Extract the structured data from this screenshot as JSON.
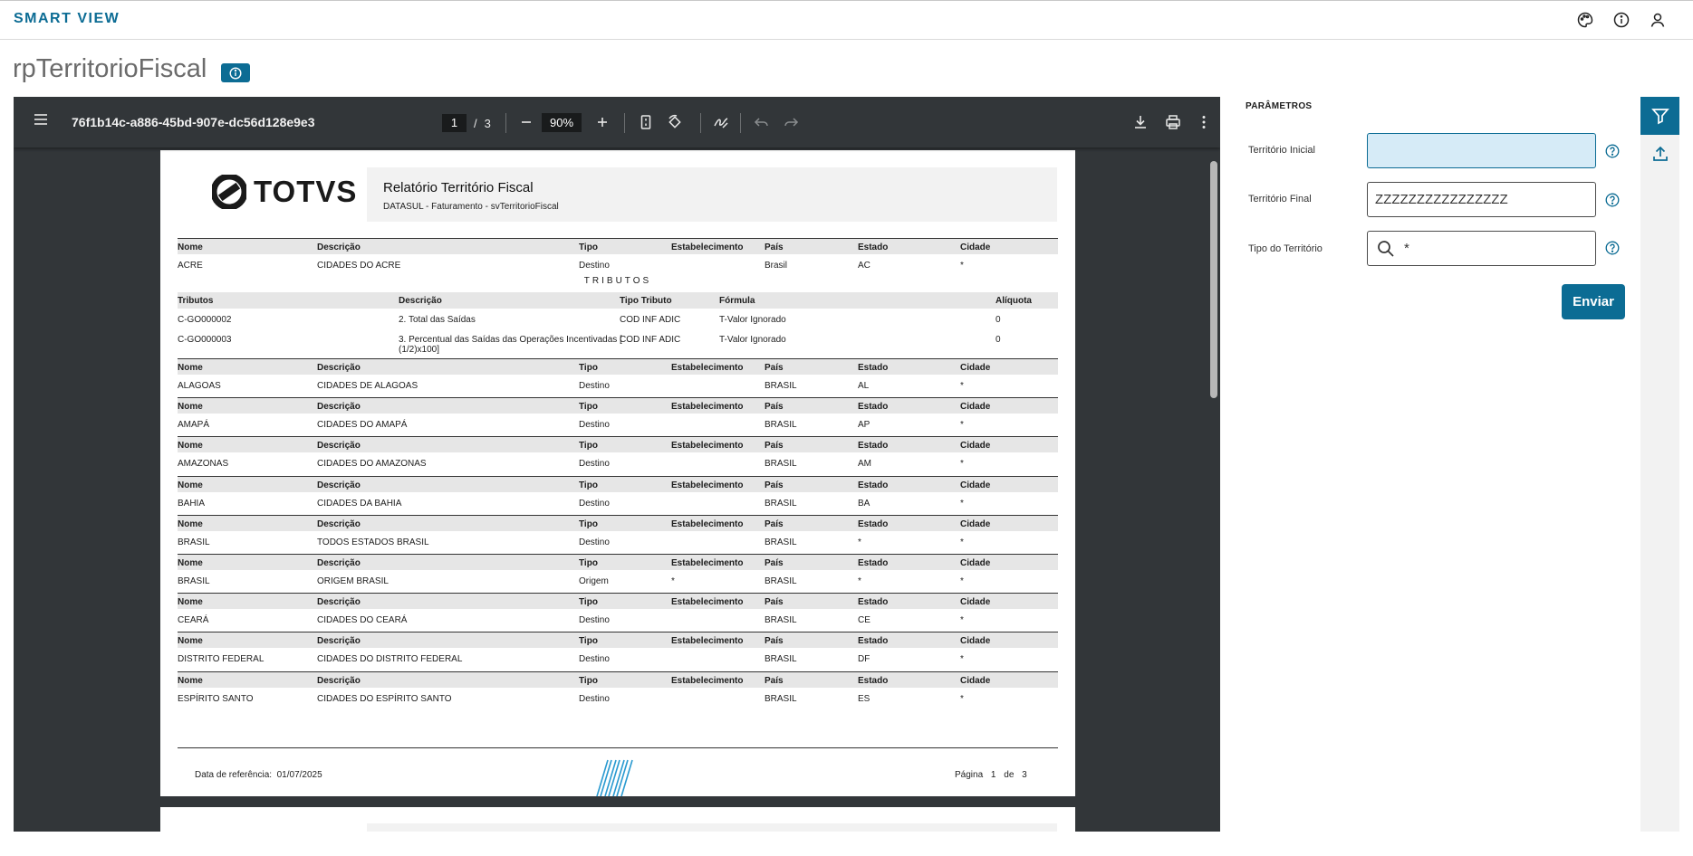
{
  "app": {
    "brand": "SMART VIEW"
  },
  "header": {
    "title": "rpTerritorioFiscal"
  },
  "viewer": {
    "doc_id": "76f1b14c-a886-45bd-907e-dc56d128e9e3",
    "page_current": "1",
    "page_sep": "/",
    "page_total": "3",
    "zoom": "90%"
  },
  "report": {
    "title": "Relatório Território Fiscal",
    "subtitle": "DATASUL - Faturamento - svTerritorioFiscal",
    "logo_text": "TOTVS",
    "headers": {
      "nome": "Nome",
      "descricao": "Descrição",
      "tipo": "Tipo",
      "estab": "Estabelecimento",
      "pais": "País",
      "estado": "Estado",
      "cidade": "Cidade"
    },
    "tributos_title": "TRIBUTOS",
    "trib_headers": {
      "tributos": "Tributos",
      "descricao": "Descrição",
      "tipo": "Tipo Tributo",
      "formula": "Fórmula",
      "aliquota": "Alíquota"
    },
    "tributos": [
      {
        "cod": "C-GO000002",
        "desc": "2. Total das Saídas",
        "desc2": "",
        "tipo": "COD INF ADIC",
        "formula": "T-Valor Ignorado",
        "aliq": "0"
      },
      {
        "cod": "C-GO000003",
        "desc": "3. Percentual das Saídas das Operações Incentivadas [",
        "desc2": "(1/2)x100]",
        "tipo": "COD INF ADIC",
        "formula": "T-Valor Ignorado",
        "aliq": "0"
      }
    ],
    "rows": [
      {
        "nome": "ACRE",
        "desc": "CIDADES DO ACRE",
        "tipo": "Destino",
        "estab": "",
        "pais": "Brasil",
        "estado": "AC",
        "cidade": "*"
      },
      {
        "nome": "ALAGOAS",
        "desc": "CIDADES DE ALAGOAS",
        "tipo": "Destino",
        "estab": "",
        "pais": "BRASIL",
        "estado": "AL",
        "cidade": "*"
      },
      {
        "nome": "AMAPÁ",
        "desc": "CIDADES DO AMAPÁ",
        "tipo": "Destino",
        "estab": "",
        "pais": "BRASIL",
        "estado": "AP",
        "cidade": "*"
      },
      {
        "nome": "AMAZONAS",
        "desc": "CIDADES DO AMAZONAS",
        "tipo": "Destino",
        "estab": "",
        "pais": "BRASIL",
        "estado": "AM",
        "cidade": "*"
      },
      {
        "nome": "BAHIA",
        "desc": "CIDADES DA BAHIA",
        "tipo": "Destino",
        "estab": "",
        "pais": "BRASIL",
        "estado": "BA",
        "cidade": "*"
      },
      {
        "nome": "BRASIL",
        "desc": "TODOS ESTADOS BRASIL",
        "tipo": "Destino",
        "estab": "",
        "pais": "BRASIL",
        "estado": "*",
        "cidade": "*"
      },
      {
        "nome": "BRASIL",
        "desc": "ORIGEM BRASIL",
        "tipo": "Origem",
        "estab": "*",
        "pais": "BRASIL",
        "estado": "*",
        "cidade": "*"
      },
      {
        "nome": "CEARÁ",
        "desc": "CIDADES DO CEARÁ",
        "tipo": "Destino",
        "estab": "",
        "pais": "BRASIL",
        "estado": "CE",
        "cidade": "*"
      },
      {
        "nome": "DISTRITO FEDERAL",
        "desc": "CIDADES DO DISTRITO FEDERAL",
        "tipo": "Destino",
        "estab": "",
        "pais": "BRASIL",
        "estado": "DF",
        "cidade": "*"
      },
      {
        "nome": "ESPÍRITO SANTO",
        "desc": "CIDADES DO ESPÍRITO SANTO",
        "tipo": "Destino",
        "estab": "",
        "pais": "BRASIL",
        "estado": "ES",
        "cidade": "*"
      }
    ],
    "footer": {
      "date_label": "Data de referência:",
      "date": "01/07/2025",
      "page_label": "Página",
      "page": "1",
      "of": "de",
      "total": "3"
    }
  },
  "params": {
    "title": "PARÂMETROS",
    "territorio_inicial_label": "Território Inicial",
    "territorio_inicial_value": "",
    "territorio_final_label": "Território Final",
    "territorio_final_value": "ZZZZZZZZZZZZZZZZ",
    "tipo_label": "Tipo do Território",
    "tipo_value": "*",
    "send_label": "Enviar"
  },
  "colors": {
    "primary": "#0c6c94",
    "viewer_bg": "#323639",
    "input_active": "#d6ebf7"
  }
}
